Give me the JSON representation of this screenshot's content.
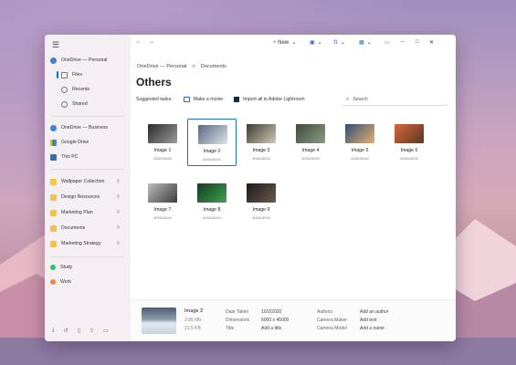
{
  "sidebar": {
    "onedrive_personal": "OneDrive — Personal",
    "files": "Files",
    "recents": "Recents",
    "shared": "Shared",
    "onedrive_business": "OneDrive — Business",
    "google_drive": "Google Drive",
    "this_pc": "This PC",
    "folders": [
      "Wallpaper Collection",
      "Design Resources",
      "Marketing Plan",
      "Documents",
      "Marketing Strategy"
    ],
    "tags": [
      {
        "label": "Study",
        "color": "#2fbf71"
      },
      {
        "label": "Work",
        "color": "#f0883e"
      }
    ]
  },
  "toolbar": {
    "new_label": "New"
  },
  "breadcrumb": [
    "OneDrive — Personal",
    ">",
    "Documents"
  ],
  "page_title": "Others",
  "suggested": {
    "label": "Suggested tasks:",
    "make_movie": "Make a movie",
    "import_lightroom": "Import all in Adobe Lightroom"
  },
  "search": {
    "placeholder": "Search"
  },
  "images": [
    {
      "name": "Image 1",
      "dims": "4032x3024",
      "colors": [
        "#2b2b2b",
        "#9a9a9a"
      ]
    },
    {
      "name": "Image 2",
      "dims": "4032x3024",
      "colors": [
        "#58697e",
        "#dbe2ea"
      ]
    },
    {
      "name": "Image 3",
      "dims": "4032x3024",
      "colors": [
        "#3d3b33",
        "#cfc8b2"
      ]
    },
    {
      "name": "Image 4",
      "dims": "4032x3024",
      "colors": [
        "#3e4a3d",
        "#8c9b83"
      ]
    },
    {
      "name": "Image 5",
      "dims": "4032x3024",
      "colors": [
        "#2e4e7a",
        "#e7b06e"
      ]
    },
    {
      "name": "Image 6",
      "dims": "4032x3024",
      "colors": [
        "#d96a3a",
        "#5a3626"
      ]
    },
    {
      "name": "Image 7",
      "dims": "4032x3024",
      "colors": [
        "#bdbdbd",
        "#3c3c3c"
      ]
    },
    {
      "name": "Image 8",
      "dims": "4032x3024",
      "colors": [
        "#143b22",
        "#3fa052"
      ]
    },
    {
      "name": "Image 9",
      "dims": "4032x3024",
      "colors": [
        "#1b1b1b",
        "#6b5b4b"
      ]
    }
  ],
  "details": {
    "name": "Image 2",
    "line2": "2.85 Mb",
    "line3": "21.5 KB",
    "date_taken_label": "Date Taken",
    "date_taken": "10/2/2020",
    "dimensions_label": "Dimensions",
    "dimensions": "6000 x 45000",
    "title_label": "Title",
    "title_value": "Add a title",
    "authors_label": "Authors",
    "authors_value": "Add an author",
    "camera_maker_label": "Camera Maker",
    "camera_maker_value": "Add text",
    "camera_model_label": "Camera Model",
    "camera_model_value": "Add a name"
  }
}
